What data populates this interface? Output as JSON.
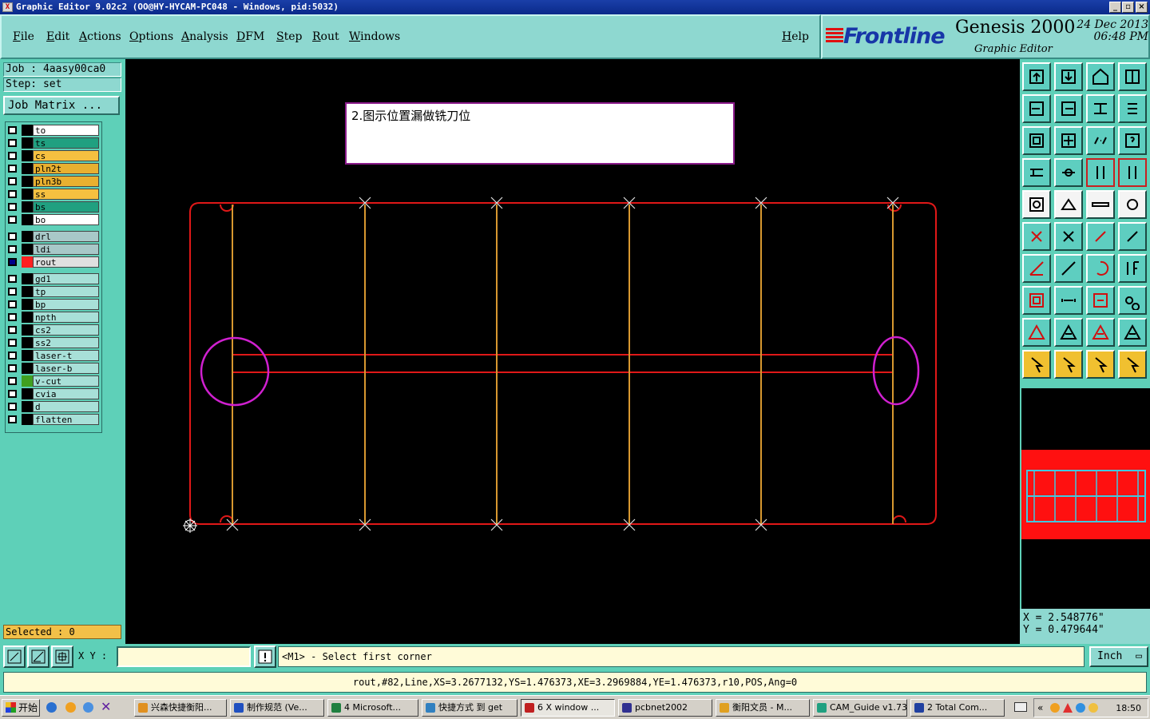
{
  "window": {
    "title": "Graphic Editor 9.02c2 (OO@HY-HYCAM-PC048 - Windows, pid:5032)"
  },
  "menu": [
    "File",
    "Edit",
    "Actions",
    "Options",
    "Analysis",
    "DFM",
    "Step",
    "Rout",
    "Windows"
  ],
  "help": "Help",
  "brand": {
    "logo": "Frontline",
    "app": "Genesis 2000",
    "subtitle": "Graphic Editor",
    "date": "24 Dec 2013",
    "time": "06:48 PM"
  },
  "job": {
    "job_line": "Job : 4aasy00ca0",
    "step_line": "Step: set",
    "matrix_button": "Job Matrix ..."
  },
  "layers": [
    {
      "name": "to",
      "color": "#ffffff",
      "swatch": "#000000",
      "active": false
    },
    {
      "name": "ts",
      "color": "#20a080",
      "swatch": "#000000",
      "active": false
    },
    {
      "name": "cs",
      "color": "#f5c040",
      "swatch": "#000000",
      "active": false
    },
    {
      "name": "pln2t",
      "color": "#e8b030",
      "swatch": "#000000",
      "active": false
    },
    {
      "name": "pln3b",
      "color": "#e8b030",
      "swatch": "#000000",
      "active": false
    },
    {
      "name": "ss",
      "color": "#f5c040",
      "swatch": "#000000",
      "active": false
    },
    {
      "name": "bs",
      "color": "#20a080",
      "swatch": "#000000",
      "active": false
    },
    {
      "name": "bo",
      "color": "#ffffff",
      "swatch": "#000000",
      "active": false
    },
    {
      "name": "drl",
      "color": "#a8c8c8",
      "swatch": "#000000",
      "active": false
    },
    {
      "name": "ldi",
      "color": "#a8c8c8",
      "swatch": "#000000",
      "active": false
    },
    {
      "name": "rout",
      "color": "#e0e0e0",
      "swatch": "#ff2020",
      "active": true
    },
    {
      "name": "gd1",
      "color": "#a8e0d8",
      "swatch": "#000000",
      "active": false
    },
    {
      "name": "tp",
      "color": "#a8e0d8",
      "swatch": "#000000",
      "active": false
    },
    {
      "name": "bp",
      "color": "#a8e0d8",
      "swatch": "#000000",
      "active": false
    },
    {
      "name": "npth",
      "color": "#a8e0d8",
      "swatch": "#000000",
      "active": false
    },
    {
      "name": "cs2",
      "color": "#a8e0d8",
      "swatch": "#000000",
      "active": false
    },
    {
      "name": "ss2",
      "color": "#a8e0d8",
      "swatch": "#000000",
      "active": false
    },
    {
      "name": "laser-t",
      "color": "#a8e0d8",
      "swatch": "#000000",
      "active": false
    },
    {
      "name": "laser-b",
      "color": "#a8e0d8",
      "swatch": "#000000",
      "active": false
    },
    {
      "name": "v-cut",
      "color": "#a8e0d8",
      "swatch": "#40a020",
      "active": false
    },
    {
      "name": "cvia",
      "color": "#a8e0d8",
      "swatch": "#000000",
      "active": false
    },
    {
      "name": "d",
      "color": "#a8e0d8",
      "swatch": "#000000",
      "active": false
    },
    {
      "name": "flatten",
      "color": "#a8e0d8",
      "swatch": "#000000",
      "active": false
    }
  ],
  "selected": "Selected : 0",
  "note": "2.图示位置漏做铣刀位",
  "coords": {
    "x": "X = 2.548776\"",
    "y": "Y = 0.479644\""
  },
  "cmd": {
    "xy_label": "X Y :",
    "xy_value": "",
    "prompt": "<M1> - Select first corner",
    "units": "Inch"
  },
  "status": "rout,#82,Line,XS=3.2677132,YS=1.476373,XE=3.2969884,YE=1.476373,r10,POS,Ang=0",
  "taskbar": {
    "start": "开始",
    "tasks": [
      {
        "label": "兴森快捷衡阳...",
        "color": "#e09020"
      },
      {
        "label": "制作规范 (Ve...",
        "color": "#2050c0"
      },
      {
        "label": "4 Microsoft...",
        "color": "#208040"
      },
      {
        "label": "快捷方式 到 get",
        "color": "#3080c0"
      },
      {
        "label": "6 X window ...",
        "color": "#c02020",
        "active": true
      },
      {
        "label": "pcbnet2002",
        "color": "#303090"
      },
      {
        "label": "衡阳文员 - M...",
        "color": "#e0a020"
      },
      {
        "label": "CAM_Guide v1.73",
        "color": "#20a080"
      },
      {
        "label": "2 Total Com...",
        "color": "#2040a0"
      }
    ],
    "clock": "18:50"
  },
  "colors": {
    "board_outline": "#e01818",
    "vcut": "#d89830",
    "highlight": "#d020d0",
    "panel": "#5ed0b8"
  }
}
